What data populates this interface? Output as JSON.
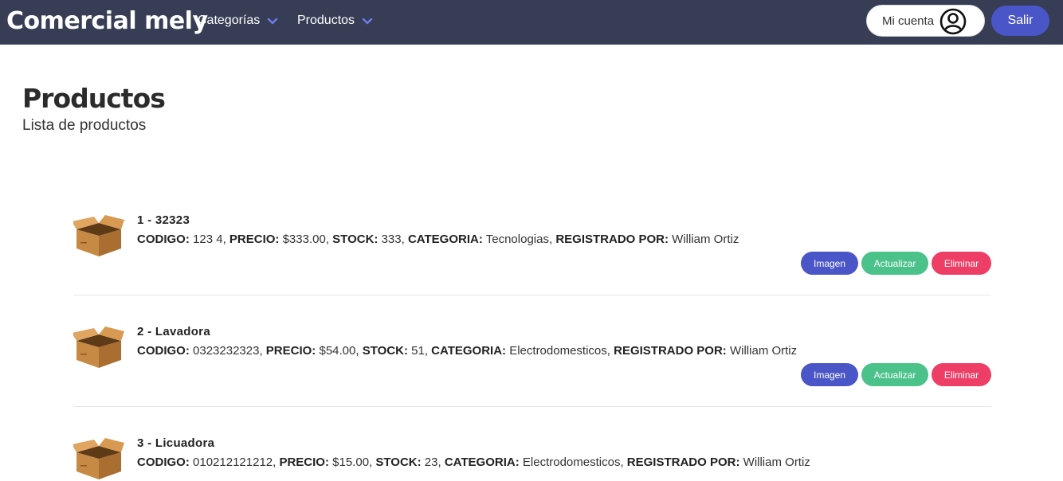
{
  "navbar": {
    "brand": "Comercial mely",
    "menu": [
      {
        "label": "Categorías",
        "icon": "chevron-down-icon"
      },
      {
        "label": "Productos",
        "icon": "chevron-down-icon"
      }
    ],
    "account_label": "Mi cuenta",
    "account_icon": "user-circle-icon",
    "logout_label": "Salir",
    "accent_color": "#4a56c7",
    "bar_color": "#363d55"
  },
  "page": {
    "title": "Productos",
    "subtitle": "Lista de productos"
  },
  "field_labels": {
    "codigo": "CODIGO:",
    "precio": "PRECIO:",
    "stock": "STOCK:",
    "categoria": "CATEGORIA:",
    "registrado": "REGISTRADO POR:"
  },
  "buttons": {
    "imagen": "Imagen",
    "actualizar": "Actualizar",
    "eliminar": "Eliminar",
    "colors": {
      "imagen": "#4a56c7",
      "actualizar": "#4ac28a",
      "eliminar": "#ef3e65"
    }
  },
  "products": [
    {
      "title": "1 - 32323",
      "codigo": "123 4",
      "precio": "$333.00",
      "stock": "333",
      "categoria": "Tecnologias",
      "registrado": "William Ortiz",
      "icon": "box-icon"
    },
    {
      "title": "2 - Lavadora",
      "codigo": "0323232323",
      "precio": "$54.00",
      "stock": "51",
      "categoria": "Electrodomesticos",
      "registrado": "William Ortiz",
      "icon": "box-icon"
    },
    {
      "title": "3 - Licuadora",
      "codigo": "010212121212",
      "precio": "$15.00",
      "stock": "23",
      "categoria": "Electrodomesticos",
      "registrado": "William Ortiz",
      "icon": "box-icon"
    }
  ]
}
